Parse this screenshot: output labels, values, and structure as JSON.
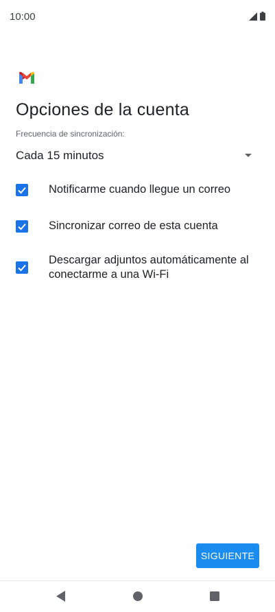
{
  "status_bar": {
    "time": "10:00",
    "icons": [
      "signal-icon",
      "battery-icon"
    ]
  },
  "header": {
    "logo": "gmail-logo",
    "title": "Opciones de la cuenta"
  },
  "sync": {
    "label": "Frecuencia de sincronización:",
    "selected": "Cada 15 minutos"
  },
  "options": [
    {
      "label": "Notificarme cuando llegue un correo",
      "checked": true
    },
    {
      "label": "Sincronizar correo de esta cuenta",
      "checked": true
    },
    {
      "label": "Descargar adjuntos automáticamente al conectarme a una Wi-Fi",
      "checked": true
    }
  ],
  "footer": {
    "next_label": "SIGUIENTE"
  },
  "nav": {
    "items": [
      "back-icon",
      "home-icon",
      "recents-icon"
    ]
  },
  "colors": {
    "accent": "#1a73e8",
    "button": "#1a8cf0"
  }
}
